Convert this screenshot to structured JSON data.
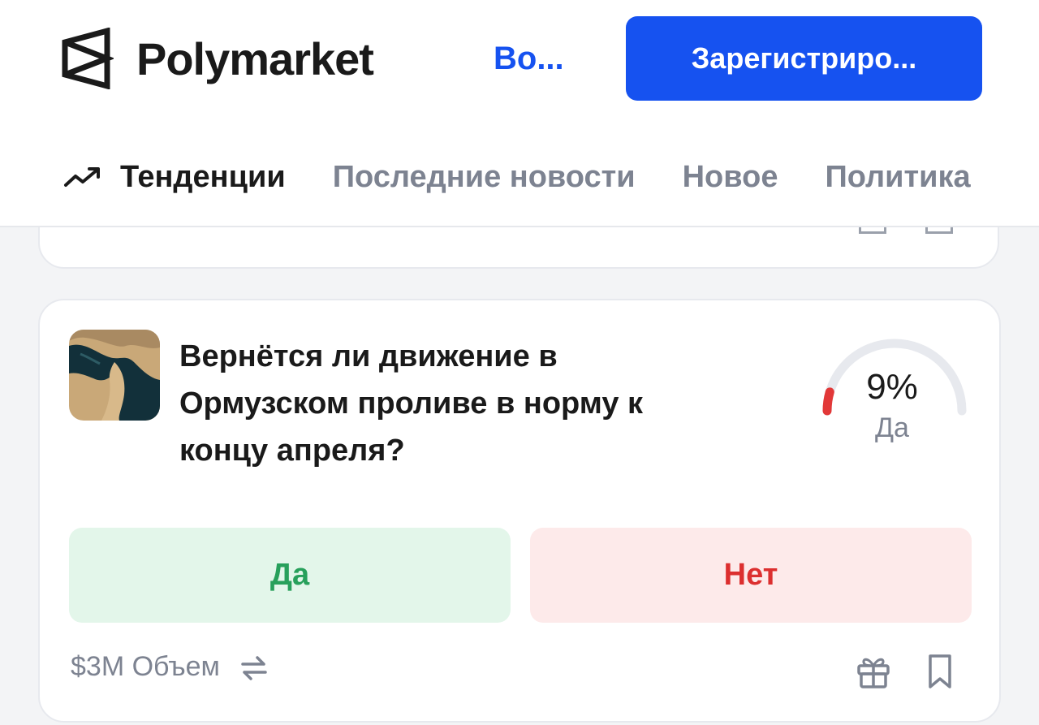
{
  "header": {
    "brand": "Polymarket",
    "login_label": "Во...",
    "signup_label": "Зарегистриро..."
  },
  "nav": {
    "items": [
      {
        "label": "Тенденции",
        "active": true,
        "icon": "trending-up-icon"
      },
      {
        "label": "Последние новости",
        "active": false
      },
      {
        "label": "Новое",
        "active": false
      },
      {
        "label": "Политика",
        "active": false
      }
    ]
  },
  "market": {
    "question": "Вернётся ли движение в Ормузском проливе в норму к концу апреля?",
    "chance_percent": 9,
    "chance_text": "9%",
    "chance_label": "Да",
    "yes_label": "Да",
    "no_label": "Нет",
    "volume": "$3M Объем"
  },
  "colors": {
    "brand_blue": "#1652f0",
    "yes_green": "#27a05b",
    "yes_bg": "#e3f6ea",
    "no_red": "#dc2f2f",
    "no_bg": "#fdeaea",
    "muted_text": "#7d8391"
  },
  "icons": [
    "polymarket-logo-icon",
    "trending-up-icon",
    "repeat-icon",
    "gift-icon",
    "bookmark-icon"
  ]
}
